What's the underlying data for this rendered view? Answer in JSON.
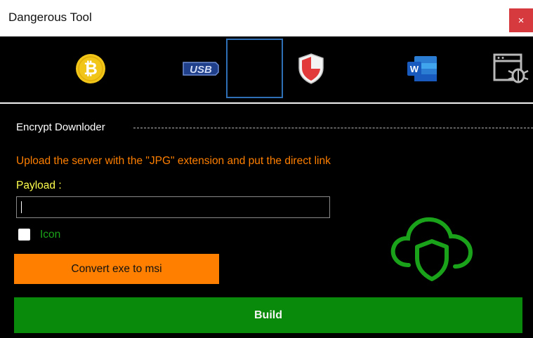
{
  "window": {
    "title": "Dangerous Tool",
    "close_label": "×"
  },
  "toolbar": {
    "items": [
      {
        "icon": "bitcoin-icon",
        "glyph": "₿"
      },
      {
        "icon": "usb-icon",
        "text": "USB"
      },
      {
        "icon": "blank-tool-icon",
        "selected": true
      },
      {
        "icon": "shield-icon"
      },
      {
        "icon": "word-icon",
        "text": "W"
      },
      {
        "icon": "window-bug-icon"
      }
    ]
  },
  "encrypt_group": {
    "label": "Encrypt Downloder"
  },
  "form": {
    "info_text": "Upload the server with the \"JPG\" extension and put the direct link",
    "payload_label": "Payload :",
    "payload_value": "",
    "icon_checkbox_label": "Icon",
    "icon_checked": false
  },
  "buttons": {
    "convert_label": "Convert exe to msi",
    "build_label": "Build"
  },
  "colors": {
    "accent_orange": "#ff7f00",
    "build_green": "#0a8a0a",
    "label_yellow": "#ffff4d",
    "icon_green": "#1aa31a",
    "selection_blue": "#2f6fb5"
  }
}
